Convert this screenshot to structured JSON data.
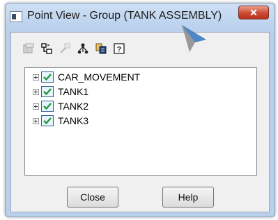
{
  "window": {
    "title": "Point View - Group (TANK ASSEMBLY)",
    "close_glyph": "✕"
  },
  "toolbar": {
    "icons": [
      "properties-icon",
      "hierarchy-icon",
      "disabled-tool-icon",
      "tree-structure-icon",
      "copy-icon",
      "help-icon"
    ],
    "help_glyph": "?"
  },
  "tree": {
    "items": [
      {
        "label": "CAR_MOVEMENT",
        "checked": true,
        "expandable": true
      },
      {
        "label": "TANK1",
        "checked": true,
        "expandable": true
      },
      {
        "label": "TANK2",
        "checked": true,
        "expandable": true
      },
      {
        "label": "TANK3",
        "checked": true,
        "expandable": true
      }
    ]
  },
  "buttons": {
    "close_label": "Close",
    "help_label": "Help"
  }
}
